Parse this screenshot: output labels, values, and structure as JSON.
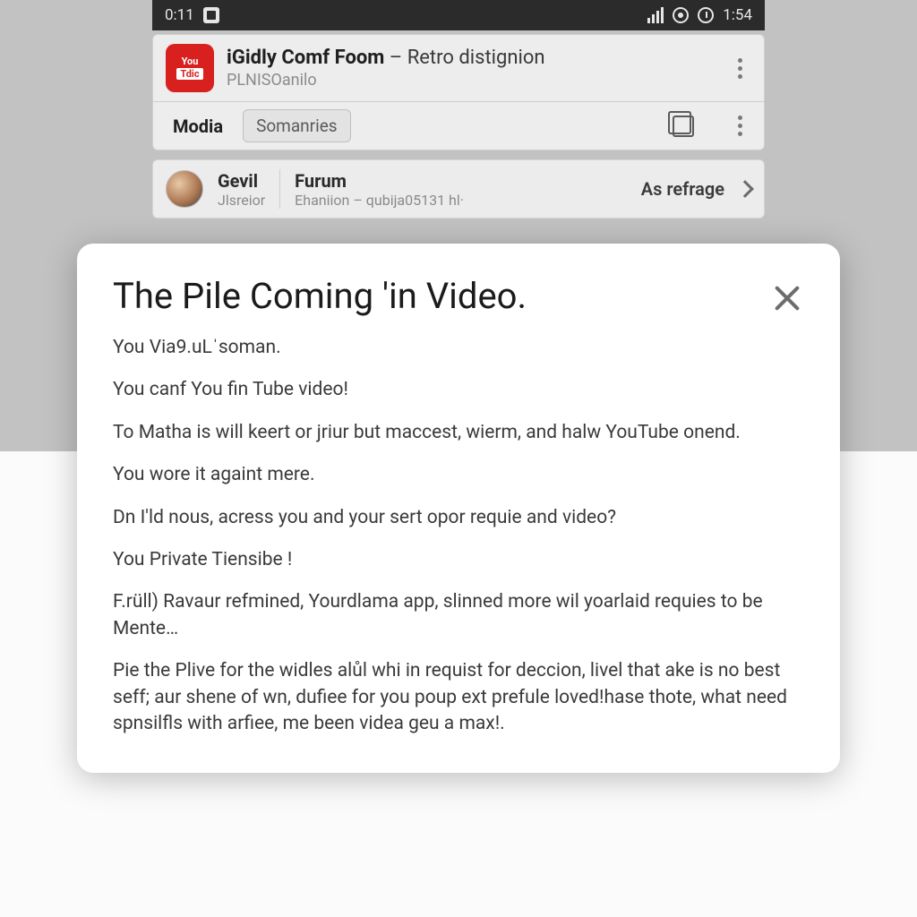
{
  "statusbar": {
    "left_time": "0:11",
    "right_time": "1:54"
  },
  "header": {
    "logo": {
      "line1": "You",
      "line2": "Tdic"
    },
    "title_bold": "iGidly Comf Foom",
    "title_rest": " – Retro distignion",
    "subtitle": "PLNISOanilo"
  },
  "tabs": {
    "modia": "Modia",
    "somanries": "Somanries"
  },
  "listrow": {
    "colA_top": "Gevil",
    "colA_bot": "Jlsreior",
    "colB_top": "Furum",
    "colB_bot": "Ehaniion – qubija05131 hl·",
    "action": "As refrage"
  },
  "dialog": {
    "title": "The Pile Coming 'in Video.",
    "p1": "You Via9.uLˈsoman.",
    "p2": "You canf You fin Tube video!",
    "p3": "To Matha is will keert or jriur but maccest, wierm, and halw YouTube onend.",
    "p4": "You wore it againt mere.",
    "p5": "Dn I'ld nous, acress you and your sert opor requie and video?",
    "p6": "You Private Tiensibe !",
    "p7": "F.rüll) Ravaur refmined, Yourdlama app, slinned more wil yoarlaid requies to be Mente…",
    "p8": "Pie the Plive for the widles alůl whi in requist for deccion, livel that ake is no best seff; aur shene of wn, dufiee for you poup ext prefule loved!hase thote, what need spnsilfls with arfiee, me been videa geu a max!."
  }
}
